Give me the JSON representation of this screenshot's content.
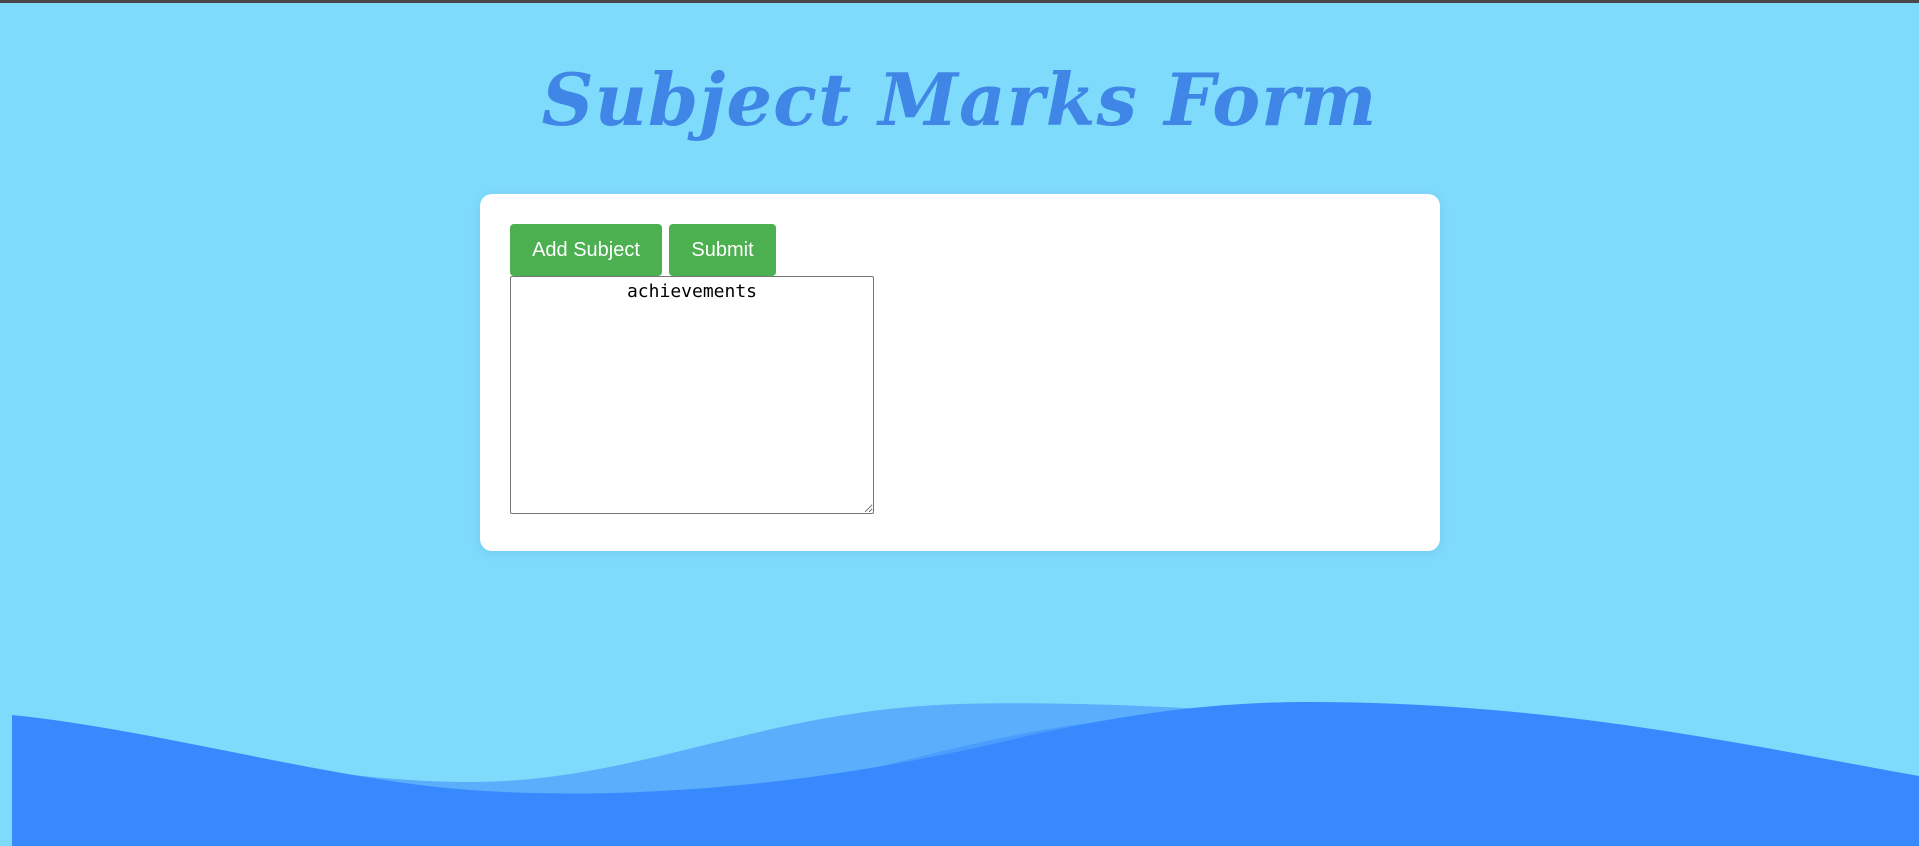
{
  "page": {
    "title": "Subject Marks Form"
  },
  "form": {
    "add_subject_label": "Add Subject",
    "submit_label": "Submit",
    "achievements_value": "achievements"
  },
  "colors": {
    "background": "#7fdbfc",
    "title": "#3f86e6",
    "button": "#4caf50",
    "wave_dark": "#3889fd",
    "wave_light": "#5aaefc"
  }
}
